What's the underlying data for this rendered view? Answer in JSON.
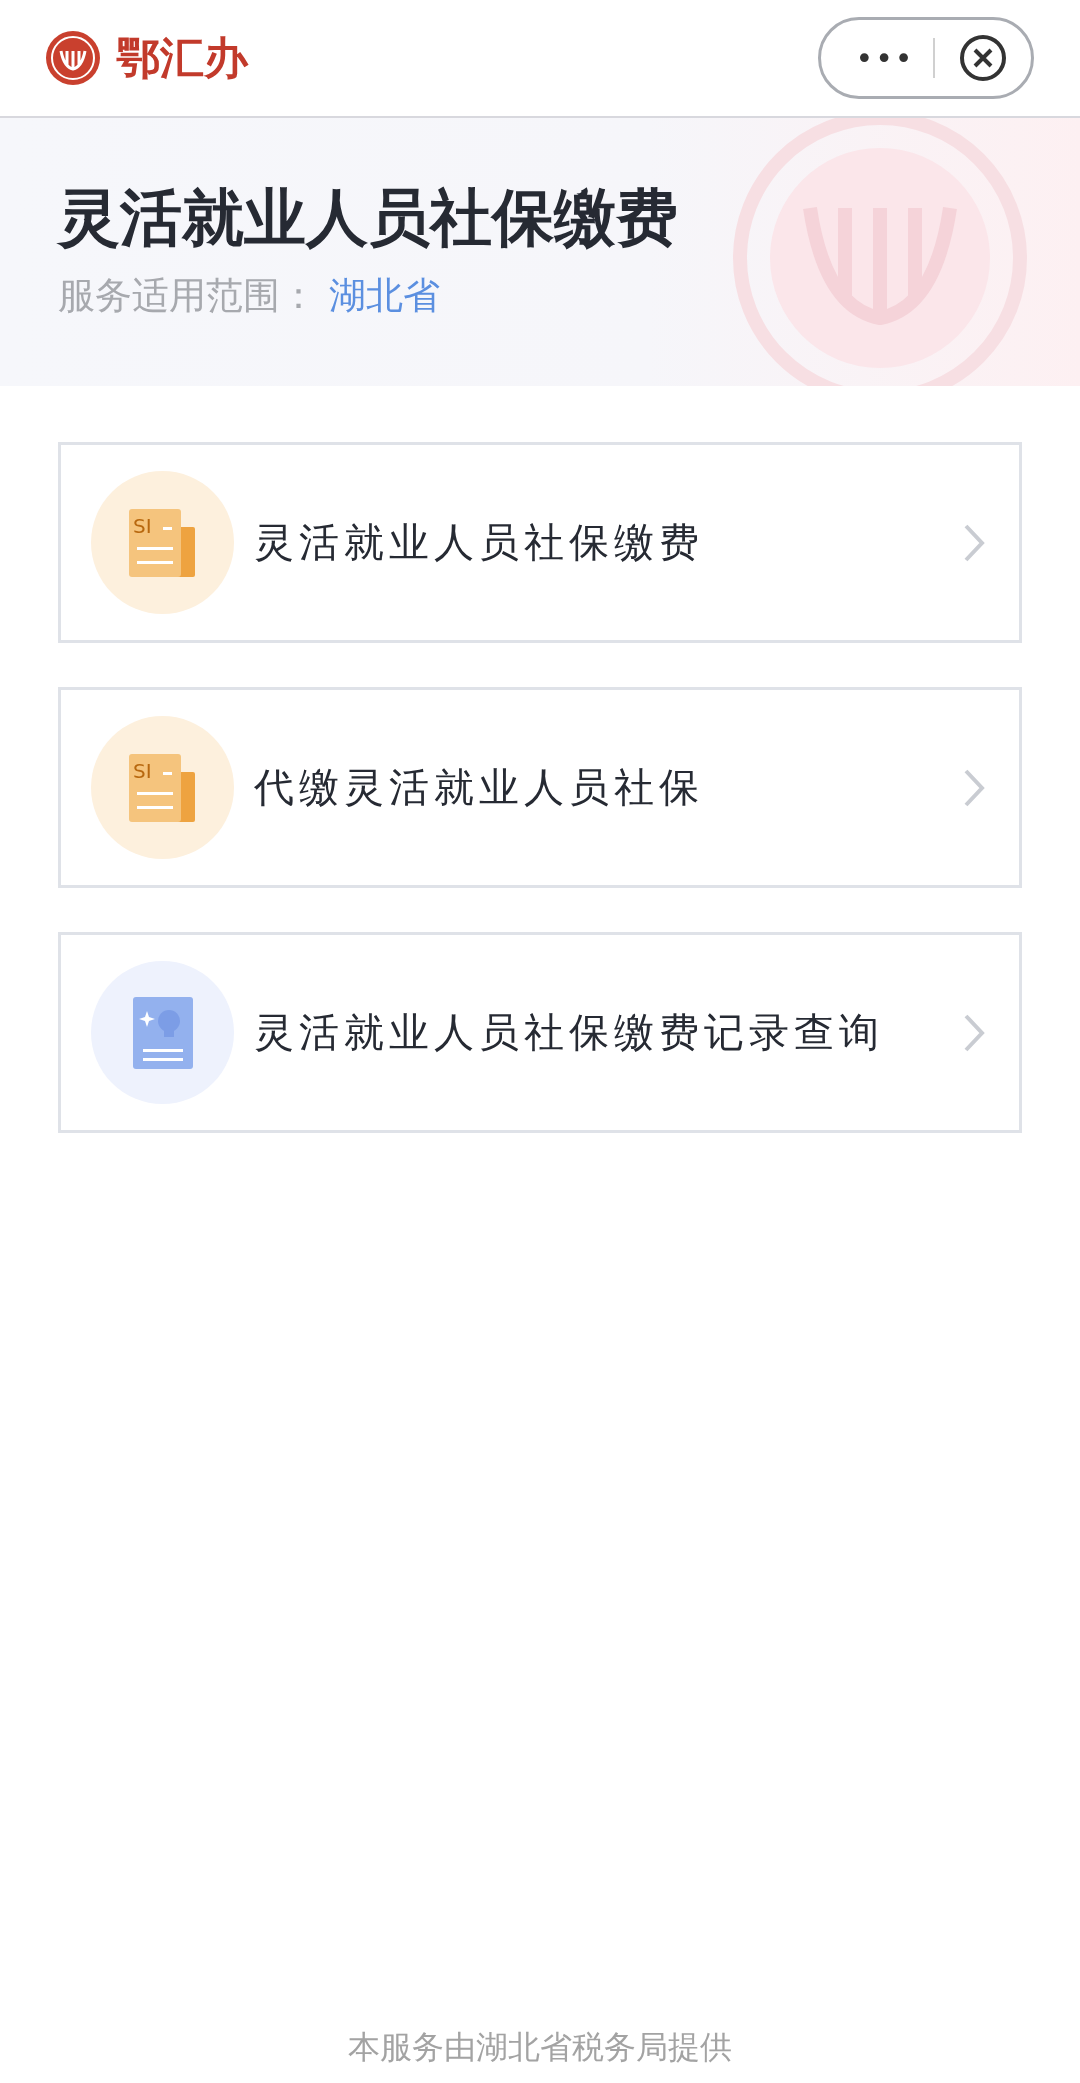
{
  "top_bar": {
    "app_name": "鄂汇办",
    "more_button": "•••"
  },
  "header": {
    "title": "灵活就业人员社保缴费",
    "scope_label": "服务适用范围：",
    "scope_value": "湖北省"
  },
  "services": [
    {
      "kind": "payment",
      "icon_label": "SI",
      "label": "灵活就业人员社保缴费"
    },
    {
      "kind": "payment",
      "icon_label": "SI",
      "label": "代缴灵活就业人员社保"
    },
    {
      "kind": "record",
      "label": "灵活就业人员社保缴费记录查询"
    }
  ],
  "footer": "本服务由湖北省税务局提供"
}
